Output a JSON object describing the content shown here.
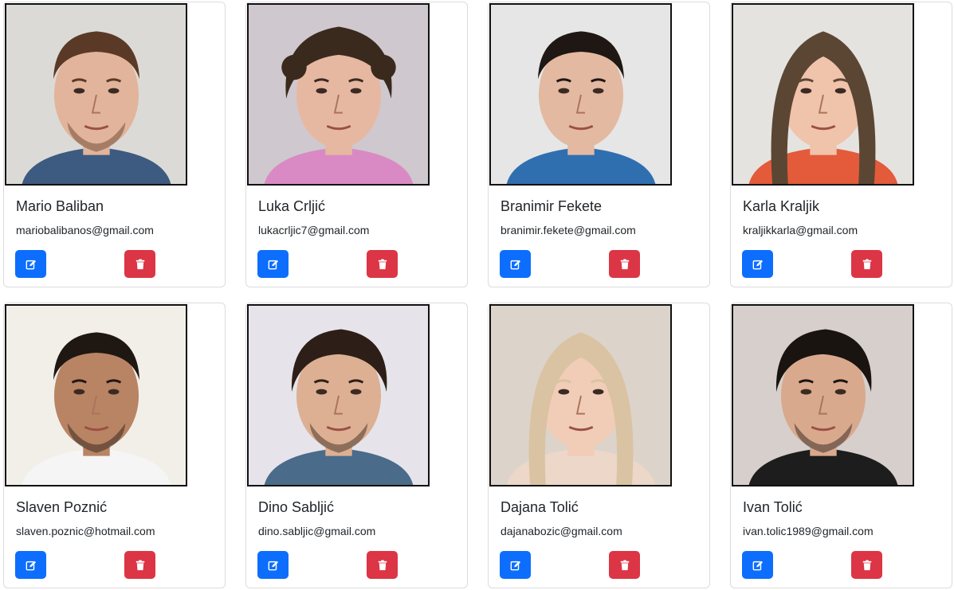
{
  "colors": {
    "edit_button": "#0d6efd",
    "delete_button": "#dc3545",
    "card_border": "#dcdcdc",
    "photo_border": "#111111",
    "text": "#212529"
  },
  "icons": {
    "edit": "edit-icon",
    "delete": "trash-icon"
  },
  "contacts": [
    {
      "name": "Mario Baliban",
      "email": "mariobalibanos@gmail.com",
      "photo": {
        "bg": "#dcdad6",
        "skin": "#e2b49b",
        "hair": "#5a3a26",
        "hair_style": "short",
        "shirt": "#3d5a80",
        "beard": true
      }
    },
    {
      "name": "Luka Crljić",
      "email": "lukacrljic7@gmail.com",
      "photo": {
        "bg": "#cfc8ce",
        "skin": "#e6b8a2",
        "hair": "#3a2a1e",
        "hair_style": "curly",
        "shirt": "#d98ac4",
        "beard": false
      }
    },
    {
      "name": "Branimir Fekete",
      "email": "branimir.fekete@gmail.com",
      "photo": {
        "bg": "#e6e6e6",
        "skin": "#e3b9a1",
        "hair": "#1e1713",
        "hair_style": "short",
        "shirt": "#2f6fb0",
        "beard": false
      }
    },
    {
      "name": "Karla Kraljik",
      "email": "kraljikkarla@gmail.com",
      "photo": {
        "bg": "#e5e3df",
        "skin": "#f0c3ab",
        "hair": "#5b4634",
        "hair_style": "long",
        "shirt": "#e35b3a",
        "beard": false
      }
    },
    {
      "name": "Slaven Poznić",
      "email": "slaven.poznic@hotmail.com",
      "photo": {
        "bg": "#f1efe8",
        "skin": "#b98464",
        "hair": "#1f1812",
        "hair_style": "short",
        "shirt": "#f5f5f5",
        "beard": true
      }
    },
    {
      "name": "Dino Sabljić",
      "email": "dino.sabljic@gmail.com",
      "photo": {
        "bg": "#e6e4ea",
        "skin": "#ddb093",
        "hair": "#2d1f17",
        "hair_style": "wavy",
        "shirt": "#4a6b8a",
        "beard": true
      }
    },
    {
      "name": "Dajana Tolić",
      "email": "dajanabozic@gmail.com",
      "photo": {
        "bg": "#dcd3cb",
        "skin": "#f1cdb8",
        "hair": "#d9c3a3",
        "hair_style": "long",
        "shirt": "#ecd7c8",
        "beard": false
      }
    },
    {
      "name": "Ivan Tolić",
      "email": "ivan.tolic1989@gmail.com",
      "photo": {
        "bg": "#d7cfcc",
        "skin": "#d9a98e",
        "hair": "#1a1411",
        "hair_style": "wavy",
        "shirt": "#1d1d1d",
        "beard": true
      }
    }
  ]
}
